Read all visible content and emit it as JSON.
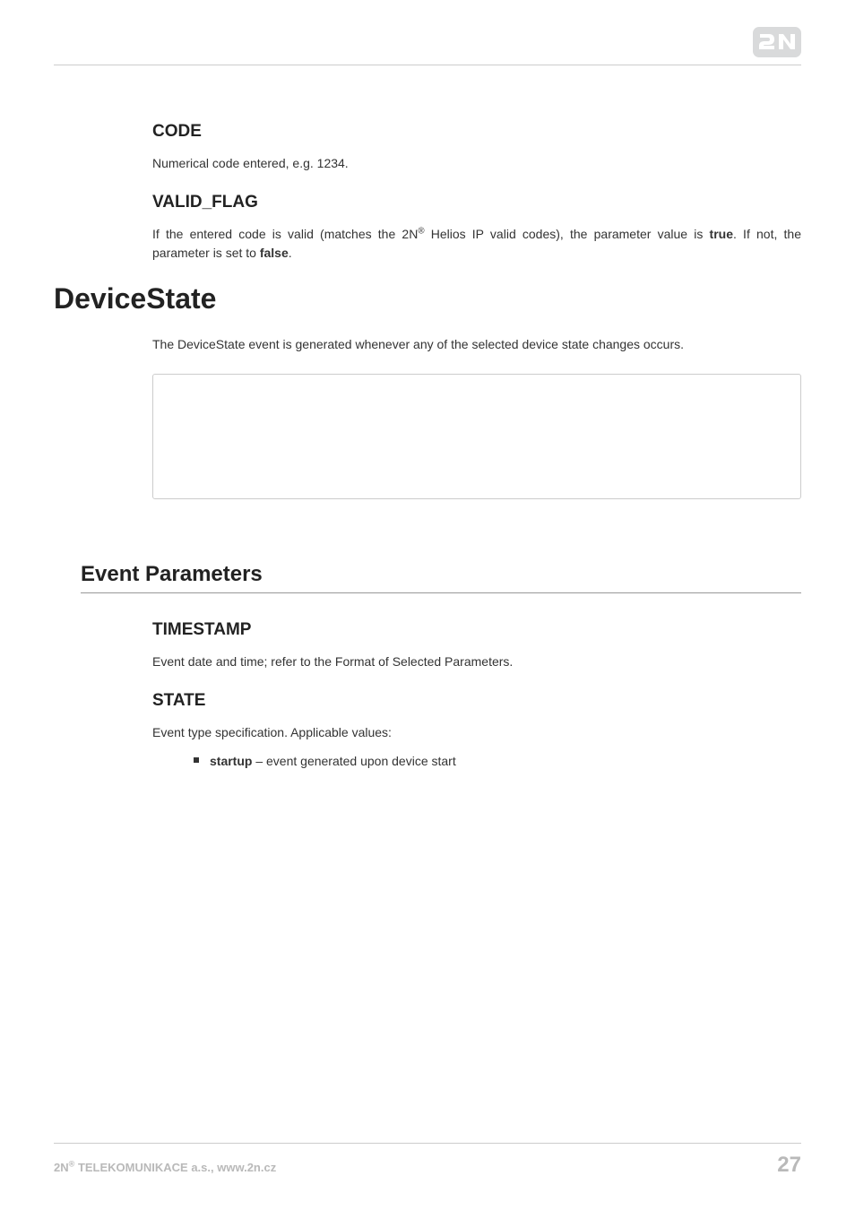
{
  "brand": "2N",
  "headings": {
    "code": "CODE",
    "valid_flag": "VALID_FLAG",
    "device_state": "DeviceState",
    "event_parameters": "Event Parameters",
    "timestamp": "TIMESTAMP",
    "state": "STATE"
  },
  "paragraphs": {
    "code_desc": "Numerical code entered, e.g. 1234.",
    "valid_flag_pre": "If the entered code is valid (matches the 2N",
    "valid_flag_mid": " Helios IP valid codes), the parameter value is ",
    "valid_flag_true": "true",
    "valid_flag_mid2": ". If not, the parameter is set to ",
    "valid_flag_false": "false",
    "valid_flag_end": ".",
    "device_state_desc": "The DeviceState event is generated whenever any of the selected device state changes occurs.",
    "timestamp_desc": "Event date and time; refer to the Format of Selected Parameters.",
    "state_desc": "Event type specification. Applicable values:"
  },
  "bullets": {
    "startup_label": "startup",
    "startup_desc": " – event generated upon device start"
  },
  "footer": {
    "company_prefix": "2N",
    "company_suffix": " TELEKOMUNIKACE a.s., www.2n.cz",
    "reg_mark": "®",
    "page_number": "27"
  }
}
